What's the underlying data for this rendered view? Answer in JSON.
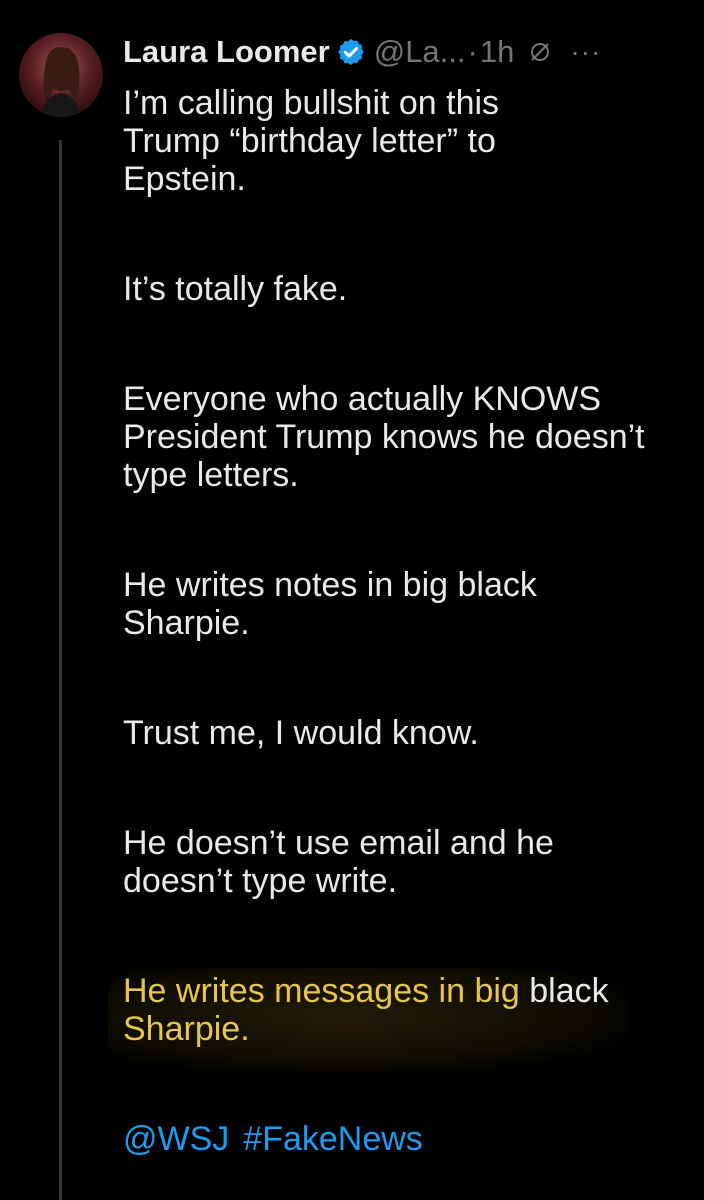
{
  "post": {
    "author_name": "Laura Loomer",
    "handle": "@La...",
    "separator": "·",
    "time": "1h",
    "more_label": "···",
    "paragraphs": [
      "I’m calling bullshit on this Trump “birthday letter” to Epstein.",
      "It’s totally fake.",
      "Everyone who actually KNOWS President Trump knows he doesn’t type letters.",
      "He writes notes in big black Sharpie.",
      "Trust me, I would know.",
      "He doesn’t use email and he doesn’t type write."
    ],
    "highlighted_text": "He writes messages in big",
    "after_highlight": " black",
    "highlighted_tail": "Sharpie.",
    "mentions": [
      "@WSJ",
      "#FakeNews"
    ]
  },
  "colors": {
    "background": "#000000",
    "text": "#e7e9ea",
    "muted": "#71767b",
    "link": "#1d9bf0",
    "verified": "#1d9bf0",
    "highlight": "#e8c551"
  },
  "icons": [
    "avatar",
    "verified-badge-icon",
    "grok-icon",
    "more-icon"
  ]
}
